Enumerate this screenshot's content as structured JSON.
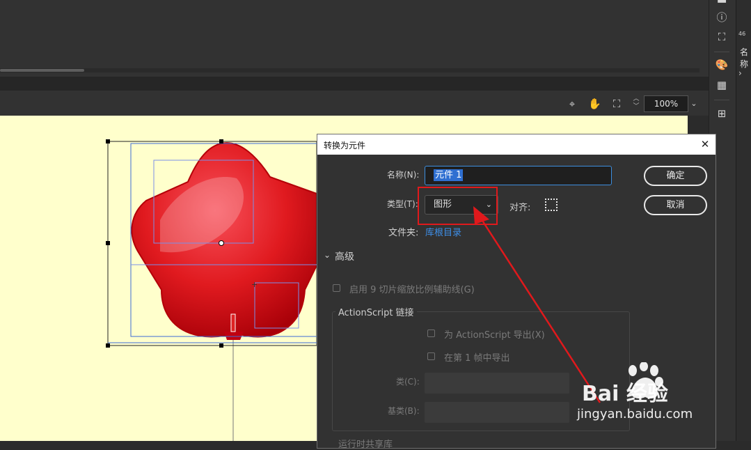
{
  "zoom": {
    "value": "100%"
  },
  "dialog": {
    "title": "转换为元件",
    "name_label": "名称(N):",
    "name_value": "元件 1",
    "type_label": "类型(T):",
    "type_value": "图形",
    "align_label": "对齐:",
    "folder_label": "文件夹:",
    "folder_value": "库根目录",
    "ok_label": "确定",
    "cancel_label": "取消",
    "advanced_label": "高级",
    "nine_slice_label": "启用 9 切片缩放比例辅助线(G)",
    "actionscript_group_label": "ActionScript 链接",
    "export_as_label": "为 ActionScript 导出(X)",
    "export_frame1_label": "在第 1 帧中导出",
    "class_label": "类(C):",
    "base_class_label": "基类(B):",
    "runtime_label": "运行时共享库"
  },
  "right_panel": {
    "number": "46",
    "label": "名称"
  },
  "colors": {
    "annotation": "#e0191c",
    "stage": "#ffffcc",
    "link": "#3e8fe8",
    "focus": "#3d8fe0"
  },
  "watermark": {
    "brand": "Bai 经验",
    "url": "jingyan.baidu.com"
  }
}
